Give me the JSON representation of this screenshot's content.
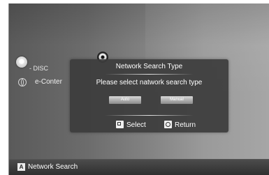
{
  "menu": {
    "disc_label": "- DISC",
    "econtent_label": "e-Conter"
  },
  "dialog": {
    "title": "Network Search Type",
    "message": "Please select natwork search type",
    "options": [
      {
        "label": "Auto"
      },
      {
        "label": "Manual"
      }
    ],
    "footer": {
      "select_label": "Select",
      "return_label": "Return"
    }
  },
  "status_bar": {
    "key": "A",
    "label": "Network Search"
  }
}
